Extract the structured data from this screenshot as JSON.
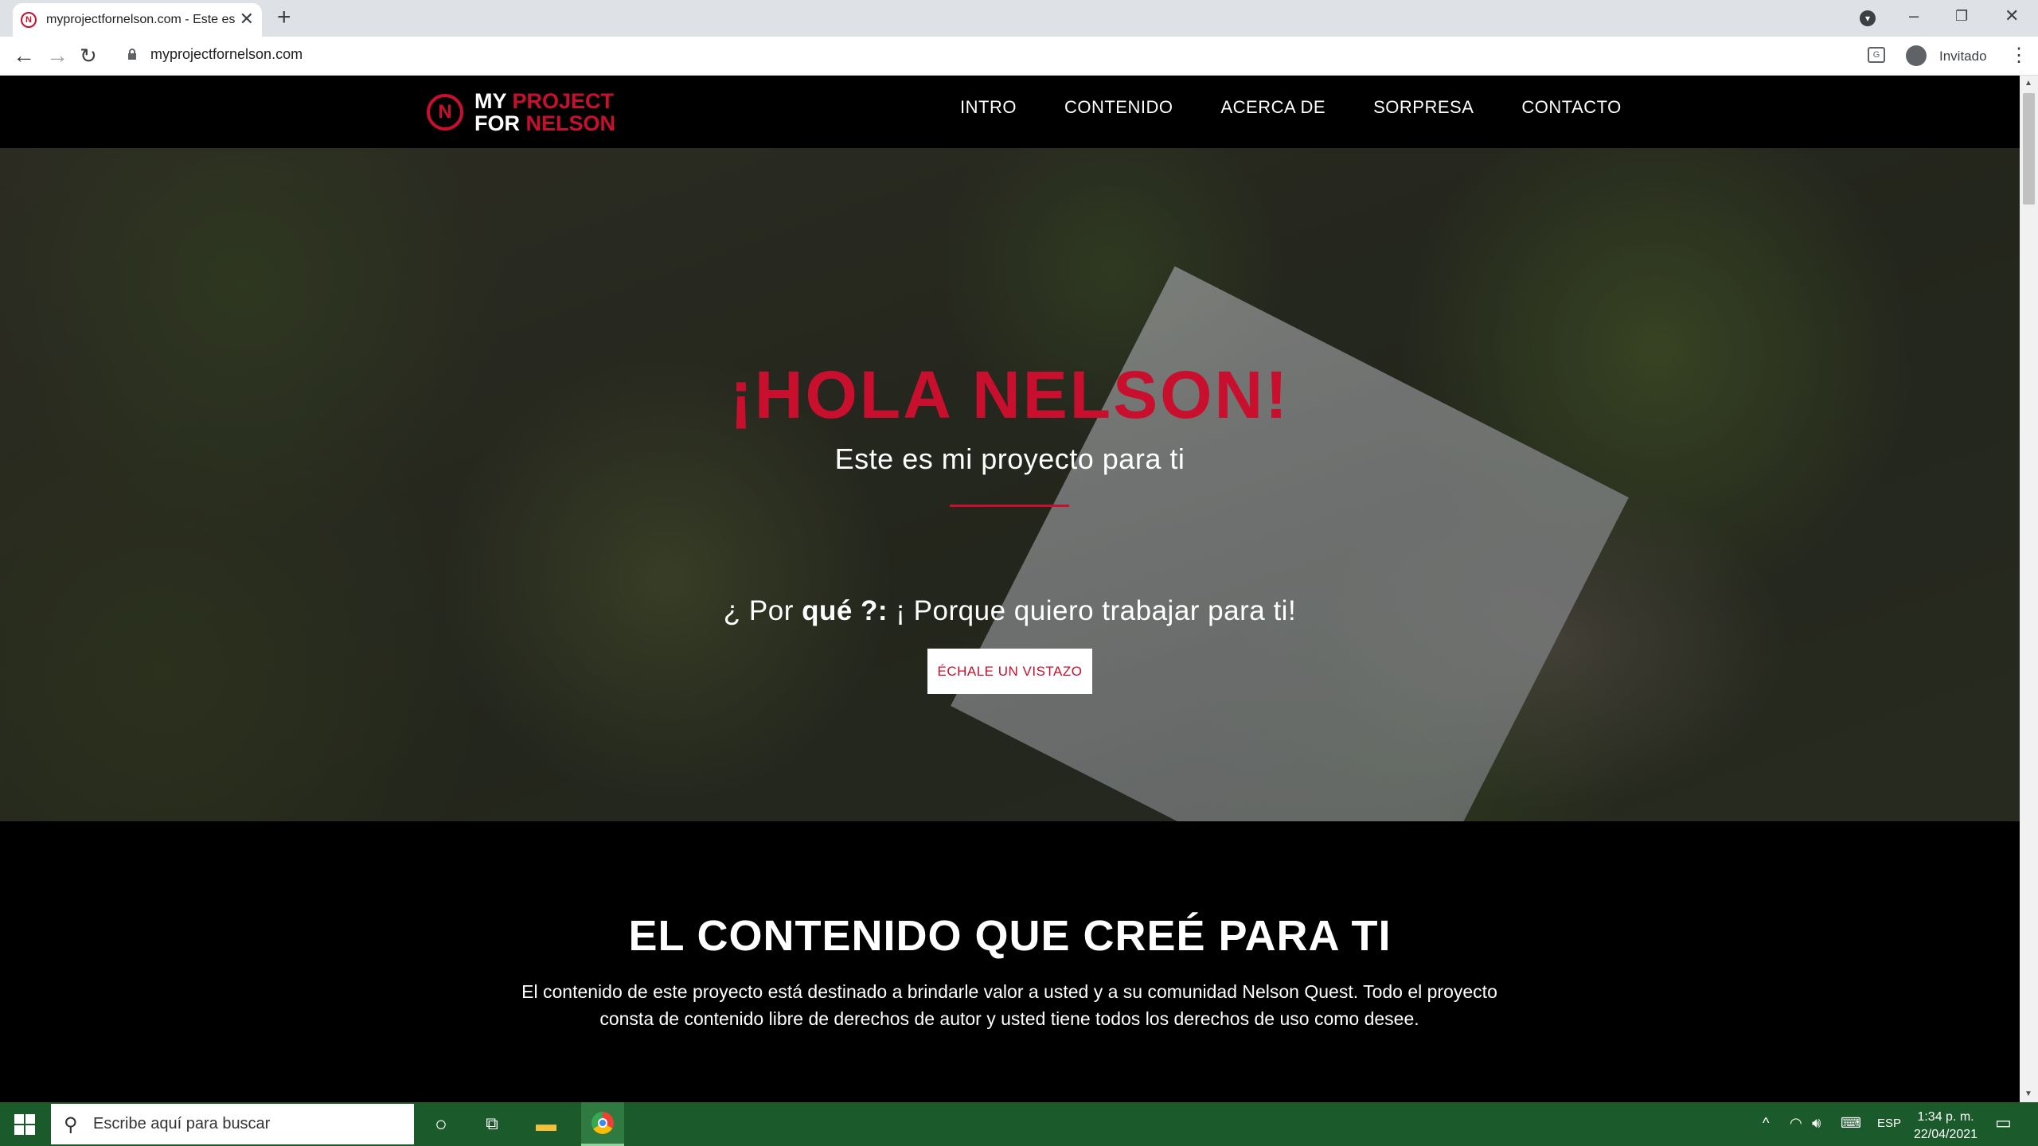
{
  "browser": {
    "tab_title": "myprojectfornelson.com - Este es",
    "tab_favicon": "N",
    "url": "myprojectfornelson.com",
    "profile_label": "Invitado"
  },
  "site": {
    "logo": {
      "mark": "N",
      "line1_white": "MY ",
      "line1_red": "PROJECT",
      "line2_white": "FOR ",
      "line2_red": "NELSON"
    },
    "nav": [
      "INTRO",
      "CONTENIDO",
      "ACERCA DE",
      "SORPRESA",
      "CONTACTO"
    ],
    "hero": {
      "title": "¡HOLA NELSON!",
      "subtitle": "Este es mi proyecto para ti",
      "tagline_pre": "¿ Por ",
      "tagline_bold": "qué ?:",
      "tagline_post": " ¡ Porque quiero trabajar para ti!",
      "button": "ÉCHALE UN VISTAZO"
    },
    "content": {
      "title": "EL CONTENIDO QUE CREÉ PARA TI",
      "text": "El contenido de este proyecto está destinado a brindarle valor a usted y a su comunidad Nelson Quest. Todo el proyecto consta de contenido libre de derechos de autor y usted tiene todos los derechos de uso como desee."
    }
  },
  "taskbar": {
    "search_placeholder": "Escribe aquí para buscar",
    "language": "ESP",
    "time": "1:34 p. m.",
    "date": "22/04/2021"
  },
  "colors": {
    "accent": "#c8102e",
    "taskbar": "#1b5a2a"
  }
}
